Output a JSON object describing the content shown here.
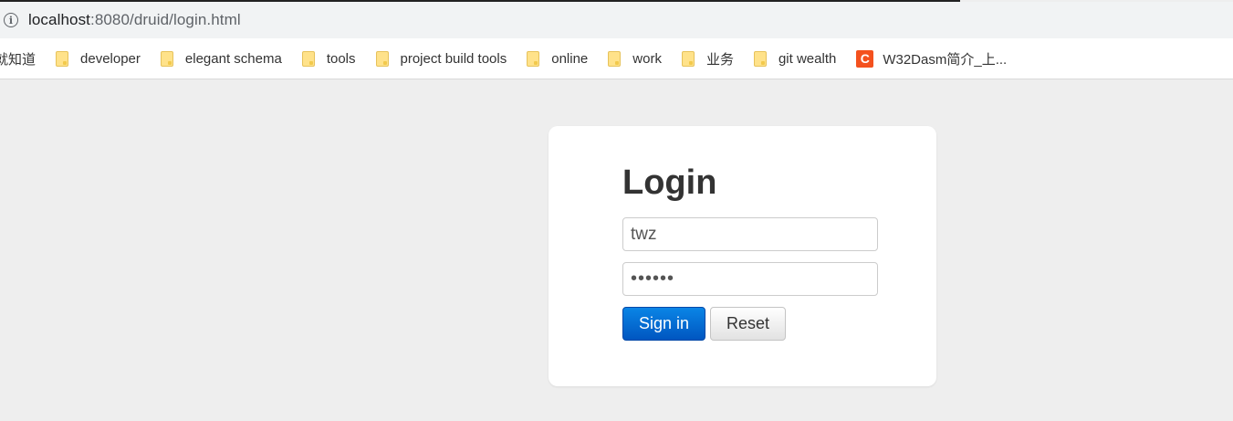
{
  "browser": {
    "url_host": "localhost",
    "url_path": ":8080/druid/login.html"
  },
  "bookmarks": {
    "partial_label": "就知道",
    "items": [
      {
        "label": "developer",
        "icon": "folder-icon"
      },
      {
        "label": "elegant schema",
        "icon": "folder-icon"
      },
      {
        "label": "tools",
        "icon": "folder-icon"
      },
      {
        "label": "project build tools",
        "icon": "folder-icon"
      },
      {
        "label": "online",
        "icon": "folder-icon"
      },
      {
        "label": "work",
        "icon": "folder-icon"
      },
      {
        "label": "业务",
        "icon": "folder-icon"
      },
      {
        "label": "git wealth",
        "icon": "folder-icon"
      },
      {
        "label": "W32Dasm简介_上...",
        "icon": "csdn-icon",
        "icon_letter": "C"
      }
    ]
  },
  "login": {
    "title": "Login",
    "username_value": "twz",
    "password_value": "••••••",
    "signin_label": "Sign in",
    "reset_label": "Reset"
  },
  "colors": {
    "background": "#eeeeee",
    "primary_button": "#0a6fd6",
    "bookmark_folder": "#ffe28a",
    "csdn_icon": "#f4511e"
  }
}
